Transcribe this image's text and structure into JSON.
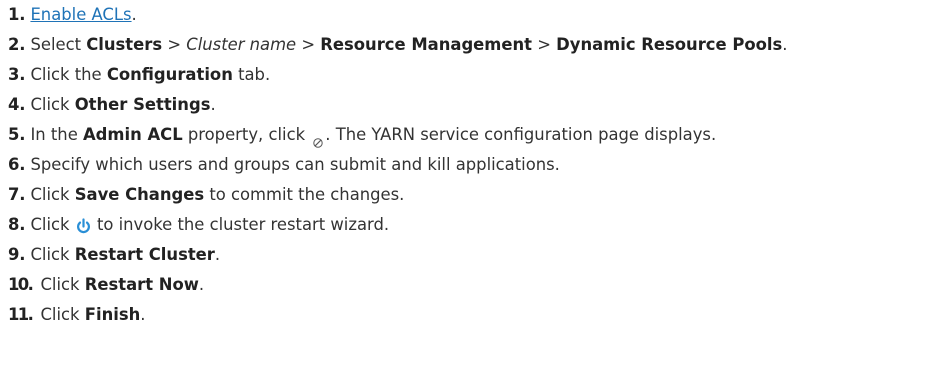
{
  "steps": [
    {
      "num": "1.",
      "link": "Enable ACLs",
      "after": "."
    },
    {
      "num": "2.",
      "t1": "Select ",
      "b1": "Clusters",
      "t2": " > ",
      "i1": "Cluster name",
      "t3": " > ",
      "b2": "Resource Management",
      "t4": " > ",
      "b3": "Dynamic Resource Pools",
      "t5": "."
    },
    {
      "num": "3.",
      "t1": "Click the ",
      "b1": "Configuration",
      "t2": " tab."
    },
    {
      "num": "4.",
      "t1": "Click ",
      "b1": "Other Settings",
      "t2": "."
    },
    {
      "num": "5.",
      "t1": "In the ",
      "b1": "Admin ACL",
      "t2": " property, click ",
      "icon": "edit-icon",
      "t3": ". The YARN service configuration page displays."
    },
    {
      "num": "6.",
      "t1": "Specify which users and groups can submit and kill applications."
    },
    {
      "num": "7.",
      "t1": "Click ",
      "b1": "Save Changes",
      "t2": " to commit the changes."
    },
    {
      "num": "8.",
      "t1": "Click ",
      "icon": "power-icon",
      "t2": " to invoke the cluster restart wizard."
    },
    {
      "num": "9.",
      "t1": "Click ",
      "b1": "Restart Cluster",
      "t2": "."
    },
    {
      "num": "10.",
      "t1": "Click ",
      "b1": "Restart Now",
      "t2": "."
    },
    {
      "num": "11.",
      "t1": "Click ",
      "b1": "Finish",
      "t2": "."
    }
  ],
  "colors": {
    "link": "#1f73b7",
    "power_icon": "#2a8fd6",
    "text": "#333333"
  }
}
